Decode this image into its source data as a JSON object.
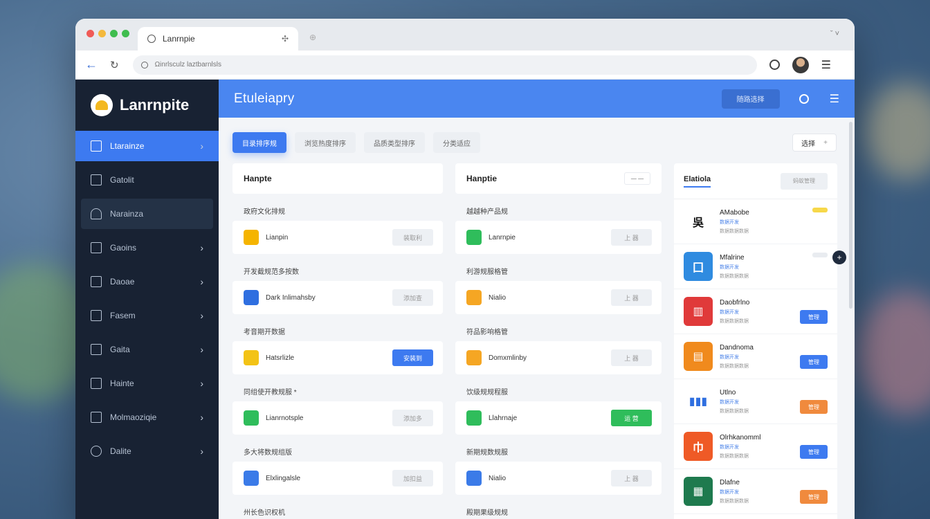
{
  "browser": {
    "tab_title": "Lanrnpie",
    "tab_close": "✣",
    "new_tab": "⊕",
    "window_controls": "ˇ ˅",
    "url": "Ωinrlsculz laztbarnlsls"
  },
  "sidebar": {
    "brand": "Lanrnpite",
    "items": [
      {
        "label": "Ltarainze",
        "icon": "dashboard-icon"
      },
      {
        "label": "Gatolit",
        "icon": "list-icon"
      },
      {
        "label": "Narainza",
        "icon": "user-icon"
      },
      {
        "label": "Gaoins",
        "icon": "book-icon"
      },
      {
        "label": "Daoae",
        "icon": "tool-icon"
      },
      {
        "label": "Fasem",
        "icon": "image-icon"
      },
      {
        "label": "Gaita",
        "icon": "page-icon"
      },
      {
        "label": "Hainte",
        "icon": "building-icon"
      },
      {
        "label": "Molmaoziqie",
        "icon": "folder-icon"
      },
      {
        "label": "Dalite",
        "icon": "clock-icon"
      }
    ]
  },
  "topbar": {
    "title": "Εtuleiapry",
    "button": "随路选择"
  },
  "filters": {
    "pills": [
      "目录排序规",
      "浏览热度排序",
      "品质类型排序",
      "分类适应"
    ],
    "sort": "选择"
  },
  "col_a": {
    "header": "Hanpte",
    "groups": [
      {
        "label": "政府文化排规",
        "app": "Lianpin",
        "action": "装取利",
        "ico_color": "#f5b400",
        "action_style": ""
      },
      {
        "label": "开发截规范多按数",
        "app": "Dark Inlimahsby",
        "action": "添加查",
        "ico_color": "#2f6fe0",
        "action_style": ""
      },
      {
        "label": "考音期开数据",
        "app": "Hatsrlizle",
        "action": "安装到",
        "ico_color": "#f3c316",
        "action_style": "blue"
      },
      {
        "label": "同组使开教规服 *",
        "app": "Lianrnotsple",
        "action": "添加多",
        "ico_color": "#2fbd5b",
        "action_style": ""
      },
      {
        "label": "多大将数规组版",
        "app": "Elxlingalsle",
        "action": "加扣益",
        "ico_color": "#3b7be8",
        "action_style": ""
      }
    ],
    "tail_label": "州长色识权机"
  },
  "col_b": {
    "header": "Hanptie",
    "header_btn": "— —",
    "groups": [
      {
        "label": "越越种产品规",
        "app": "Lanrnpie",
        "action": "上 器",
        "ico_color": "#2fbd5b",
        "action_style": ""
      },
      {
        "label": "利游规服格管",
        "app": "Nialio",
        "action": "上 器",
        "ico_color": "#f5a623",
        "action_style": ""
      },
      {
        "label": "符品影响格管",
        "app": "Domxmlinby",
        "action": "上 器",
        "ico_color": "#f5a623",
        "action_style": ""
      },
      {
        "label": "饮级规规程服",
        "app": "Llahrnaje",
        "action": "运 营",
        "ico_color": "#2fbd5b",
        "action_style": "green"
      },
      {
        "label": "新期规数规服",
        "app": "Nialio",
        "action": "上 器",
        "ico_color": "#3b7be8",
        "action_style": ""
      }
    ],
    "tail_label": "殿期果级规规"
  },
  "right_panel": {
    "tab": "Elatiola",
    "button": "蚂蚁管理",
    "items": [
      {
        "name": "AMabobe",
        "sub": "数据开发",
        "sub2": "数据数据数据",
        "glyph": "吳",
        "ico_color": "#ffffff",
        "glyph_color": "#111111",
        "tag_color": "#f7d84a",
        "action": "",
        "action_color": ""
      },
      {
        "name": "Mfalrine",
        "sub": "数据开发",
        "sub2": "数据数据数据",
        "glyph": "囗",
        "ico_color": "#2f8be0",
        "glyph_color": "#ffffff",
        "tag_color": "#e9ecf0",
        "action": "",
        "action_color": ""
      },
      {
        "name": "Daobfrlno",
        "sub": "数据开发",
        "sub2": "数据数据数据",
        "glyph": "▥",
        "ico_color": "#e03a3a",
        "glyph_color": "#ffffff",
        "tag_color": "",
        "action": "管理",
        "action_color": "#3d7af0"
      },
      {
        "name": "Dandnoma",
        "sub": "数据开发",
        "sub2": "数据数据数据",
        "glyph": "▤",
        "ico_color": "#f08a1d",
        "glyph_color": "#ffffff",
        "tag_color": "",
        "action": "管理",
        "action_color": "#3d7af0"
      },
      {
        "name": "Utlno",
        "sub": "数据开发",
        "sub2": "数据数据数据",
        "glyph": "▮▮▮",
        "ico_color": "#ffffff",
        "glyph_color": "#2f6fe0",
        "tag_color": "",
        "action": "管理",
        "action_color": "#f08a3d"
      },
      {
        "name": "Olrhkanomml",
        "sub": "数据开发",
        "sub2": "数据数据数据",
        "glyph": "巾",
        "ico_color": "#ef5a26",
        "glyph_color": "#ffffff",
        "tag_color": "",
        "action": "管理",
        "action_color": "#3d7af0"
      },
      {
        "name": "Dlafne",
        "sub": "数据开发",
        "sub2": "数据数据数据",
        "glyph": "▦",
        "ico_color": "#1e7a4e",
        "glyph_color": "#ffffff",
        "tag_color": "",
        "action": "管理",
        "action_color": "#f08a3d"
      }
    ]
  },
  "colors": {
    "accent": "#3d7af0",
    "sidebar_bg": "#182233",
    "topbar_bg": "#4a86f0"
  }
}
